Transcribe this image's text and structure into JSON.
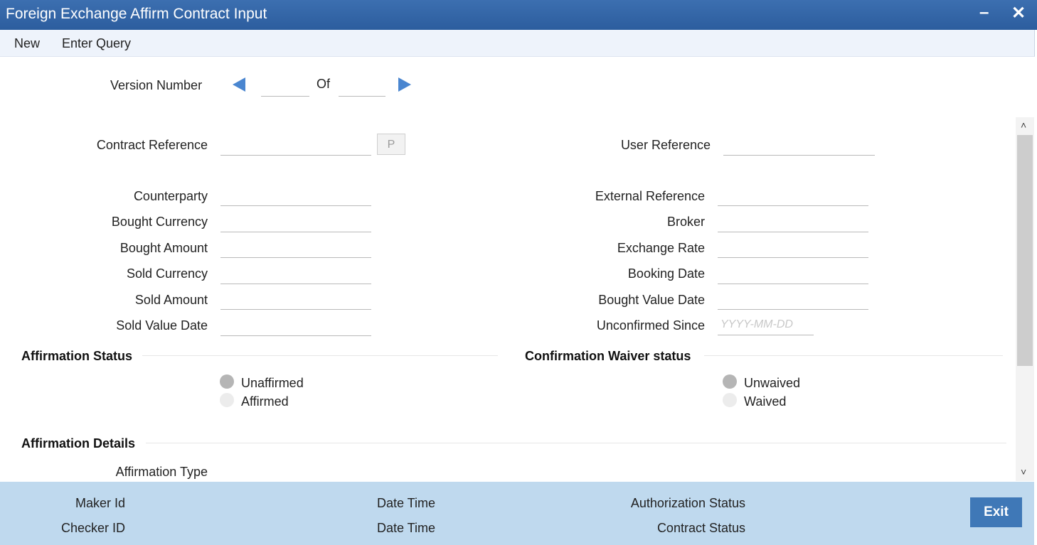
{
  "window": {
    "title": "Foreign Exchange Affirm Contract Input",
    "minimize": "–",
    "close": "✕"
  },
  "menu": {
    "new": "New",
    "enter_query": "Enter Query"
  },
  "version": {
    "label": "Version Number",
    "of": "Of",
    "current": "",
    "total": ""
  },
  "form": {
    "contract_reference": {
      "label": "Contract Reference",
      "value": "",
      "button": "P"
    },
    "user_reference": {
      "label": "User Reference",
      "value": ""
    },
    "counterparty": {
      "label": "Counterparty",
      "value": ""
    },
    "bought_currency": {
      "label": "Bought Currency",
      "value": ""
    },
    "bought_amount": {
      "label": "Bought Amount",
      "value": ""
    },
    "sold_currency": {
      "label": "Sold Currency",
      "value": ""
    },
    "sold_amount": {
      "label": "Sold Amount",
      "value": ""
    },
    "sold_value_date": {
      "label": "Sold Value Date",
      "value": ""
    },
    "external_reference": {
      "label": "External Reference",
      "value": ""
    },
    "broker": {
      "label": "Broker",
      "value": ""
    },
    "exchange_rate": {
      "label": "Exchange Rate",
      "value": ""
    },
    "booking_date": {
      "label": "Booking Date",
      "value": ""
    },
    "bought_value_date": {
      "label": "Bought Value Date",
      "value": ""
    },
    "unconfirmed_since": {
      "label": "Unconfirmed Since",
      "value": "",
      "placeholder": "YYYY-MM-DD"
    }
  },
  "affirmation_status": {
    "title": "Affirmation Status",
    "options": [
      "Unaffirmed",
      "Affirmed"
    ],
    "selected": "Unaffirmed"
  },
  "waiver_status": {
    "title": "Confirmation Waiver status",
    "options": [
      "Unwaived",
      "Waived"
    ],
    "selected": "Unwaived"
  },
  "affirmation_details": {
    "title": "Affirmation Details",
    "type_label": "Affirmation Type"
  },
  "footer": {
    "maker_id": "Maker Id",
    "checker_id": "Checker ID",
    "date_time_1": "Date Time",
    "date_time_2": "Date Time",
    "authorization_status": "Authorization Status",
    "contract_status": "Contract Status",
    "exit": "Exit"
  },
  "colors": {
    "titlebar": "#2c5d9e",
    "footer": "#bfd9ee",
    "exit_button": "#3f78b7",
    "arrow": "#4a86d0"
  }
}
